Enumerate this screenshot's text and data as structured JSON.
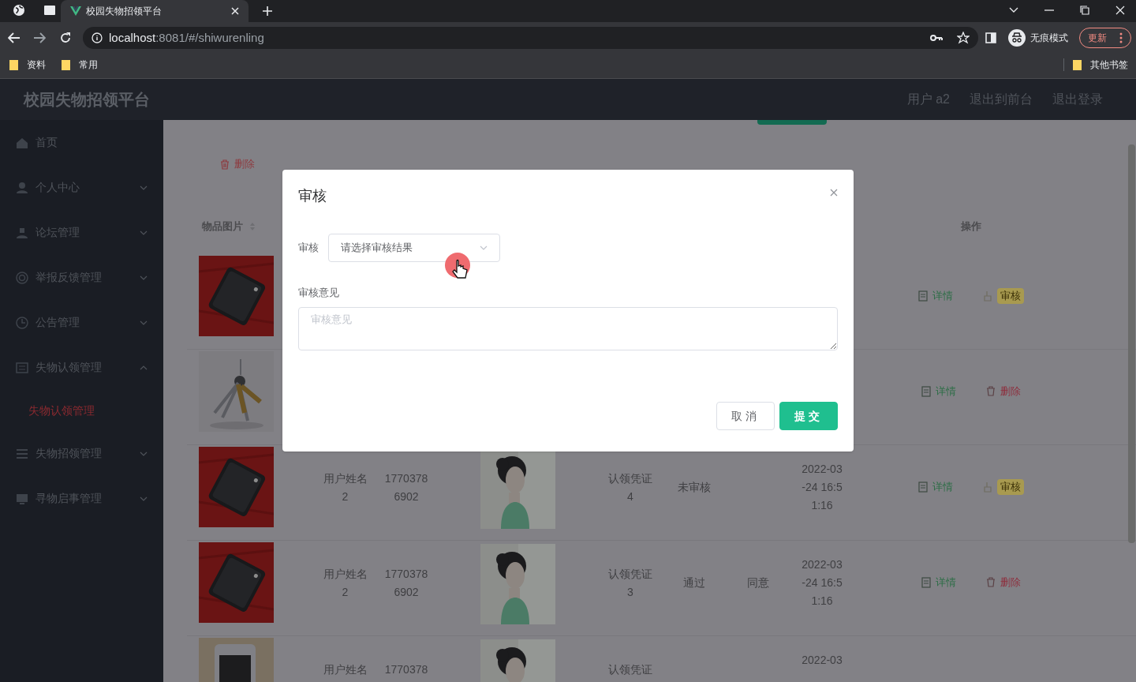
{
  "browser": {
    "tab_title": "校园失物招领平台",
    "url_host": "localhost",
    "url_rest": ":8081/#/shiwurenling",
    "profile_label": "无痕模式",
    "update_button": "更新",
    "bookmarks": [
      "资料",
      "常用"
    ],
    "other_bookmarks": "其他书签"
  },
  "header": {
    "title": "校园失物招领平台",
    "links": [
      "用户 a2",
      "退出到前台",
      "退出登录"
    ]
  },
  "sidebar": {
    "items": [
      {
        "label": "首页",
        "kind": "link"
      },
      {
        "label": "个人中心",
        "kind": "submenu",
        "expanded": false
      },
      {
        "label": "论坛管理",
        "kind": "submenu",
        "expanded": false
      },
      {
        "label": "举报反馈管理",
        "kind": "submenu",
        "expanded": false
      },
      {
        "label": "公告管理",
        "kind": "submenu",
        "expanded": false
      },
      {
        "label": "失物认领管理",
        "kind": "submenu",
        "expanded": true,
        "children": [
          {
            "label": "失物认领管理",
            "selected": true
          }
        ]
      },
      {
        "label": "失物招领管理",
        "kind": "submenu",
        "expanded": false
      },
      {
        "label": "寻物启事管理",
        "kind": "submenu",
        "expanded": false
      }
    ]
  },
  "toolbar": {
    "delete_button": "删除"
  },
  "table": {
    "columns": [
      {
        "label": "物品图片",
        "sortable": true
      },
      {
        "label": "操作",
        "sortable": false
      }
    ],
    "rows": [
      {
        "actions": [
          {
            "label": "详情",
            "kind": "detail"
          },
          {
            "label": "审核",
            "kind": "review"
          }
        ]
      },
      {
        "actions": [
          {
            "label": "详情",
            "kind": "detail"
          },
          {
            "label": "删除",
            "kind": "delete"
          }
        ]
      },
      {
        "name": "用户姓名2",
        "phone": "17703786902",
        "voucher": "认领凭证4",
        "status": "未审核",
        "date": "2022-03-24 16:51:16",
        "actions": [
          {
            "label": "详情",
            "kind": "detail"
          },
          {
            "label": "审核",
            "kind": "review"
          }
        ]
      },
      {
        "name": "用户姓名2",
        "phone": "17703786902",
        "voucher": "认领凭证3",
        "status": "通过",
        "opinion": "同意",
        "date": "2022-03-24 16:51:16",
        "actions": [
          {
            "label": "详情",
            "kind": "detail"
          },
          {
            "label": "删除",
            "kind": "delete"
          }
        ]
      },
      {
        "name": "用户姓名",
        "phone": "1770378",
        "voucher": "认领凭证",
        "date": "2022-03"
      }
    ]
  },
  "dialog": {
    "title": "审核",
    "result_label": "审核",
    "result_placeholder": "请选择审核结果",
    "opinion_label": "审核意见",
    "opinion_placeholder": "审核意见",
    "buttons": [
      {
        "label": "取消",
        "kind": "secondary"
      },
      {
        "label": "提交",
        "kind": "primary"
      }
    ]
  }
}
